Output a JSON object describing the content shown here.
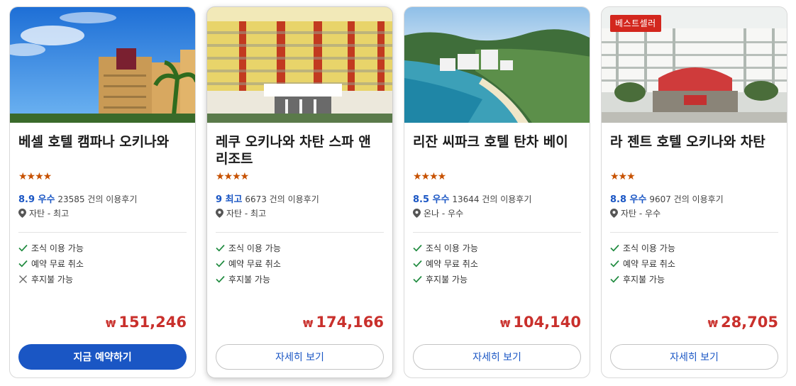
{
  "hotels": [
    {
      "name": "베셀 호텔 캠파나 오키나와",
      "stars": "★★★★",
      "score": "8.9 우수",
      "reviews": "23585 건의 이용후기",
      "location": "자탄 - 최고",
      "features": [
        {
          "label": "조식 이용 가능",
          "ok": true
        },
        {
          "label": "예약 무료 취소",
          "ok": true
        },
        {
          "label": "후지불 가능",
          "ok": false
        }
      ],
      "currency": "₩",
      "price": "151,246",
      "button": "지금 예약하기",
      "badge": ""
    },
    {
      "name": "레쿠 오키나와 차탄 스파 앤 리조트",
      "stars": "★★★★",
      "score": "9 최고",
      "reviews": "6673 건의 이용후기",
      "location": "자탄 - 최고",
      "features": [
        {
          "label": "조식 이용 가능",
          "ok": true
        },
        {
          "label": "예약 무료 취소",
          "ok": true
        },
        {
          "label": "후지불 가능",
          "ok": true
        }
      ],
      "currency": "₩",
      "price": "174,166",
      "button": "자세히 보기",
      "badge": ""
    },
    {
      "name": "리잔 씨파크 호텔 탄차 베이",
      "stars": "★★★★",
      "score": "8.5 우수",
      "reviews": "13644 건의 이용후기",
      "location": "온나 - 우수",
      "features": [
        {
          "label": "조식 이용 가능",
          "ok": true
        },
        {
          "label": "예약 무료 취소",
          "ok": true
        },
        {
          "label": "후지불 가능",
          "ok": true
        }
      ],
      "currency": "₩",
      "price": "104,140",
      "button": "자세히 보기",
      "badge": ""
    },
    {
      "name": "라 젠트 호텔 오키나와 차탄",
      "stars": "★★★",
      "score": "8.8 우수",
      "reviews": "9607 건의 이용후기",
      "location": "자탄 - 우수",
      "features": [
        {
          "label": "조식 이용 가능",
          "ok": true
        },
        {
          "label": "예약 무료 취소",
          "ok": true
        },
        {
          "label": "후지불 가능",
          "ok": true
        }
      ],
      "currency": "₩",
      "price": "28,705",
      "button": "자세히 보기",
      "badge": "베스트셀러"
    }
  ],
  "colors": {
    "accent": "#1a56c4",
    "price": "#c9302c",
    "star": "#c75100",
    "check": "#1e8a3e",
    "badge": "#d3271e"
  },
  "icons": {
    "location": "map-pin-icon",
    "check": "check-icon",
    "cross": "cross-icon"
  }
}
